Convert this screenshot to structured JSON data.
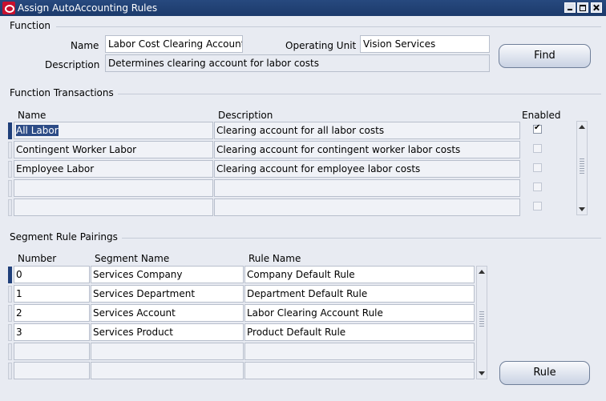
{
  "window": {
    "title": "Assign AutoAccounting Rules"
  },
  "function_section": {
    "title": "Function",
    "name_label": "Name",
    "name_value": "Labor Cost Clearing Account",
    "operating_unit_label": "Operating Unit",
    "operating_unit_value": "Vision Services",
    "description_label": "Description",
    "description_value": "Determines clearing account for labor costs",
    "find_button": "Find"
  },
  "transactions": {
    "title": "Function Transactions",
    "headers": {
      "name": "Name",
      "description": "Description",
      "enabled": "Enabled"
    },
    "rows": [
      {
        "name": "All Labor",
        "description": "Clearing account for all labor costs",
        "enabled": true
      },
      {
        "name": "Contingent Worker Labor",
        "description": "Clearing account for contingent worker labor costs",
        "enabled": false
      },
      {
        "name": "Employee Labor",
        "description": "Clearing account for employee labor costs",
        "enabled": false
      },
      {
        "name": "",
        "description": "",
        "enabled": false
      },
      {
        "name": "",
        "description": "",
        "enabled": false
      }
    ]
  },
  "pairings": {
    "title": "Segment Rule Pairings",
    "headers": {
      "number": "Number",
      "segment": "Segment Name",
      "rule": "Rule Name"
    },
    "rows": [
      {
        "number": "0",
        "segment": "Services Company",
        "rule": "Company Default Rule"
      },
      {
        "number": "1",
        "segment": "Services Department",
        "rule": "Department Default Rule"
      },
      {
        "number": "2",
        "segment": "Services Account",
        "rule": "Labor Clearing Account Rule"
      },
      {
        "number": "3",
        "segment": "Services Product",
        "rule": "Product Default Rule"
      },
      {
        "number": "",
        "segment": "",
        "rule": ""
      },
      {
        "number": "",
        "segment": "",
        "rule": ""
      }
    ],
    "rule_button": "Rule"
  }
}
